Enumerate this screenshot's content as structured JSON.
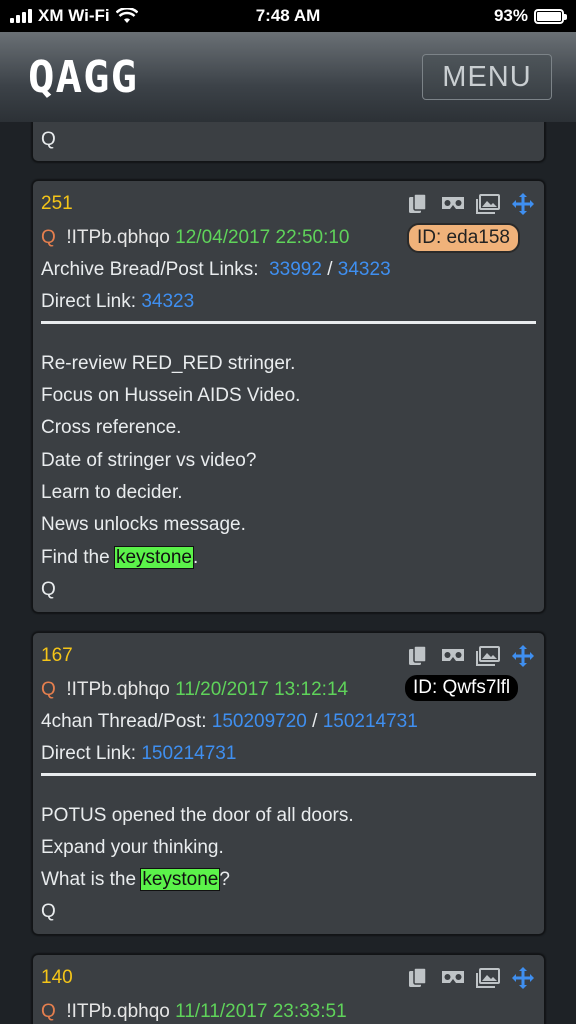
{
  "status": {
    "carrier": "XM Wi-Fi",
    "time": "7:48 AM",
    "battery": "93%"
  },
  "header": {
    "logo": "QAGG",
    "menu_label": "MENU"
  },
  "prev_card": {
    "sign": "Q"
  },
  "posts": [
    {
      "num": "251",
      "q": "Q",
      "trip": "!ITPb.qbhqo",
      "date": "12/04/2017 22:50:10",
      "id": "ID: eda158",
      "link1_label": "Archive Bread/Post Links:",
      "link1_a": "33992",
      "sep": "/",
      "link1_b": "34323",
      "direct_label": "Direct Link:",
      "direct": "34323",
      "body": [
        "Re-review RED_RED stringer.",
        "Focus on Hussein AIDS Video.",
        "Cross reference.",
        "Date of stringer vs video?",
        "Learn to decider.",
        "News unlocks message."
      ],
      "last_pre": "Find the ",
      "highlight": "keystone",
      "last_post": ".",
      "sign": "Q"
    },
    {
      "num": "167",
      "q": "Q",
      "trip": "!ITPb.qbhqo",
      "date": "11/20/2017 13:12:14",
      "id": "ID: Qwfs7lfl",
      "link1_label": "4chan Thread/Post:",
      "link1_a": "150209720",
      "sep": "/",
      "link1_b": "150214731",
      "direct_label": "Direct Link:",
      "direct": "150214731",
      "body": [
        "POTUS opened the door of all doors.",
        "Expand your thinking."
      ],
      "last_pre": "What is the ",
      "highlight": "keystone",
      "last_post": "?",
      "sign": "Q"
    },
    {
      "num": "140",
      "q": "Q",
      "trip": "!ITPb.qbhqo",
      "date": "11/11/2017 23:33:51"
    }
  ],
  "icons": [
    "copy-icon",
    "vr-icon",
    "images-icon",
    "move-icon"
  ],
  "colors": {
    "post_number": "#f5c518",
    "date": "#5fd35a",
    "link": "#3f8ff0",
    "highlight": "#5bf24a",
    "id_orange": "#f0b27a"
  }
}
